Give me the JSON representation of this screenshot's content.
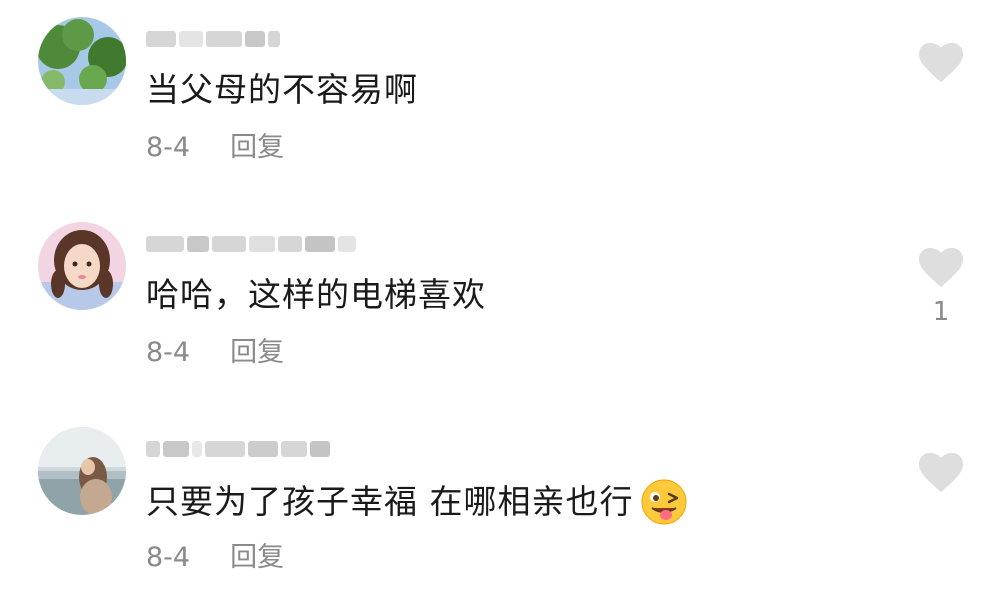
{
  "comments": [
    {
      "text": "当父母的不容易啊",
      "date": "8-4",
      "reply": "回复",
      "likes": ""
    },
    {
      "text": "哈哈，这样的电梯喜欢",
      "date": "8-4",
      "reply": "回复",
      "likes": "1"
    },
    {
      "text": "只要为了孩子幸福 在哪相亲也行",
      "date": "8-4",
      "reply": "回复",
      "likes": "",
      "emoji": "wink-tongue-emoji"
    }
  ],
  "colors": {
    "like": "#dedede",
    "meta": "#8a8a8a",
    "text": "#1a1a1a"
  }
}
